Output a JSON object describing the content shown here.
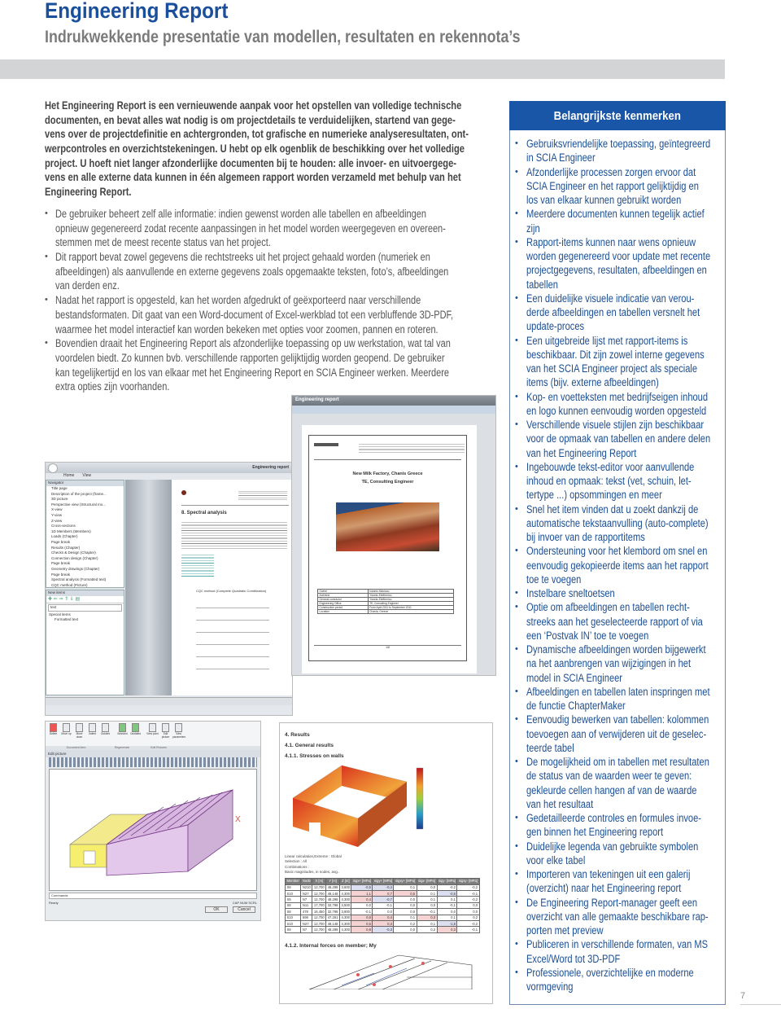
{
  "header": {
    "title": "Engineering Report",
    "subtitle": "Indrukwekkende presentatie van modellen, resultaten en rekennota’s"
  },
  "intro": {
    "lines": [
      "Het Engineering Report is een vernieuwende aanpak voor het opstellen van volledige technische",
      "documenten, en bevat alles wat nodig is om projectdetails te verduidelijken, startend van gege-",
      "vens over de projectdefinitie en achtergronden, tot grafische en numerieke analyseresultaten, ont-",
      "werpcontroles en overzichtstekeningen. U hebt op elk ogenblik de beschikking over het volledige",
      "project. U hoeft niet langer afzonderlijke documenten bij te houden: alle invoer- en uitvoergege-",
      "vens en alle externe data kunnen in één algemeen rapport worden verzameld met behulp van het",
      "Engineering Report."
    ]
  },
  "bullets": [
    {
      "lines": [
        "De gebruiker beheert zelf alle informatie: indien gewenst worden alle tabellen en afbeeldingen",
        "opnieuw gegenereerd zodat recente aanpassingen in het model worden weergegeven en overeen-",
        "stemmen met de meest recente status van het project."
      ]
    },
    {
      "lines": [
        "Dit rapport bevat zowel gegevens die rechtstreeks uit het project gehaald worden (numeriek en",
        "afbeeldingen) als aanvullende en externe gegevens zoals opgemaakte teksten, foto’s, afbeeldingen",
        "van derden enz."
      ]
    },
    {
      "lines": [
        "Nadat het rapport is opgesteld, kan het worden afgedrukt of geëxporteerd naar verschillende",
        "bestandsformaten. Dit gaat van een Word-document of Excel-werkblad tot een verbluffende 3D-PDF,",
        "waarmee het model interactief kan worden bekeken met opties voor zoomen, pannen en roteren."
      ]
    },
    {
      "lines": [
        "Bovendien draait het Engineering Report als afzonderlijke toepassing op uw werkstation, wat tal van",
        "voordelen biedt. Zo kunnen bvb. verschillende rapporten gelijktijdig worden geopend. De gebruiker",
        "kan tegelijkertijd en los van elkaar met het Engineering Report en SCIA Engineer werken. Meerdere",
        "extra opties zijn voorhanden."
      ]
    }
  ],
  "sidebar": {
    "title": "Belangrijkste kenmerken",
    "accent": "#1a56a8",
    "items": [
      {
        "lines": [
          "Gebruiksvriendelijke toepassing, geïntegreerd",
          "in SCIA Engineer"
        ]
      },
      {
        "lines": [
          "Afzonderlijke processen zorgen ervoor dat",
          "SCIA Engineer en het rapport gelijktijdig en",
          "los van elkaar kunnen gebruikt worden"
        ]
      },
      {
        "lines": [
          "Meerdere documenten kunnen tegelijk actief",
          "zijn"
        ]
      },
      {
        "lines": [
          "Rapport-items kunnen naar wens opnieuw",
          "worden gegenereerd voor update met recente",
          "projectgegevens, resultaten, afbeeldingen en",
          "tabellen"
        ]
      },
      {
        "lines": [
          "Een duidelijke visuele indicatie van verou-",
          "derde afbeeldingen en tabellen versnelt het",
          "update-proces"
        ]
      },
      {
        "lines": [
          "Een uitgebreide lijst met rapport-items is",
          "beschikbaar. Dit zijn zowel interne gegevens",
          "van het SCIA Engineer project als speciale",
          "items (bijv. externe afbeeldingen)"
        ]
      },
      {
        "lines": [
          "Kop- en voetteksten met bedrijfseigen inhoud",
          "en logo kunnen eenvoudig worden opgesteld"
        ]
      },
      {
        "lines": [
          "Verschillende visuele stijlen zijn beschikbaar",
          "voor de opmaak van tabellen en andere delen",
          "van het Engineering Report"
        ]
      },
      {
        "lines": [
          "Ingebouwde tekst-editor voor aanvullende",
          "inhoud en opmaak: tekst (vet, schuin, let-",
          "tertype ...) opsommingen en meer"
        ]
      },
      {
        "lines": [
          "Snel het item vinden dat u zoekt dankzij de",
          "automatische tekstaanvulling (auto-complete)",
          "bij invoer van de rapportitems"
        ]
      },
      {
        "lines": [
          "Ondersteuning voor het klembord om snel en",
          "eenvoudig gekopieerde items aan het rapport",
          "toe te voegen"
        ]
      },
      {
        "lines": [
          "Instelbare sneltoetsen"
        ]
      },
      {
        "lines": [
          "Optie om afbeeldingen en tabellen recht-",
          "streeks aan het geselecteerde rapport of via",
          "een ‘Postvak IN’ toe te voegen"
        ]
      },
      {
        "lines": [
          "Dynamische afbeeldingen worden bijgewerkt",
          "na het aanbrengen van wijzigingen in het",
          "model in SCIA Engineer"
        ]
      },
      {
        "lines": [
          "Afbeeldingen en tabellen laten inspringen met",
          "de functie ChapterMaker"
        ]
      },
      {
        "lines": [
          "Eenvoudig bewerken van tabellen: kolommen",
          "toevoegen aan of verwijderen uit de geselec-",
          "teerde tabel"
        ]
      },
      {
        "lines": [
          "De mogelijkheid om in tabellen met resultaten",
          "de status van de waarden weer te geven:",
          "gekleurde cellen hangen af van de waarde",
          "van het resultaat"
        ]
      },
      {
        "lines": [
          "Gedetailleerde controles en formules invoe-",
          "gen binnen het Engineering report"
        ]
      },
      {
        "lines": [
          "Duidelijke legenda van gebruikte symbolen",
          "voor elke tabel"
        ]
      },
      {
        "lines": [
          "Importeren van tekeningen uit een galerij",
          "(overzicht) naar het Engineering report"
        ]
      },
      {
        "lines": [
          "De Engineering Report-manager geeft een",
          "overzicht van alle gemaakte beschikbare rap-",
          "porten met preview"
        ]
      },
      {
        "lines": [
          "Publiceren in verschillende formaten, van MS",
          "Excel/Word tot 3D-PDF"
        ]
      },
      {
        "lines": [
          "Professionele, overzichtelijke en moderne",
          "vormgeving"
        ]
      }
    ]
  },
  "page_number": "7",
  "shot_app": {
    "window_title": "Engineering report",
    "menu": [
      "Home",
      "View"
    ],
    "navigator_title": "Navigator",
    "navigator_items": [
      "Title page",
      "Description of the project (frame...",
      "3D picture",
      "Perspective view (Structural mo...",
      "X-view",
      "Y-view",
      "Z-view",
      "Cross-sections",
      "1D Members (Members)",
      "Loads (Chapter)",
      "Page break",
      "Results (Chapter)",
      "Checks & Design (Chapter)",
      "Connection design (Chapter)",
      "Page break",
      "Geometry drawings (Chapter)",
      "Page break",
      "Spectral analysis (Formatted text)",
      "CQC method (Picture)"
    ],
    "new_items_title": "New items",
    "search_value": "text",
    "tree": [
      "Special items",
      "Formatted text"
    ],
    "doc_heading": "8. Spectral analysis",
    "doc_formula_title": "CQC method (Complete Quadratic Combination)"
  },
  "shot_report": {
    "window_title": "Engineering report",
    "doc_title": "New Milk Factory, Chanis Greece",
    "doc_subtitle": "TE, Consulting Engineer",
    "table": [
      [
        "Owner",
        "Ioannis Nikolaou"
      ],
      [
        "Architect",
        "Yiannis Eleftheriou"
      ],
      [
        "General contractor",
        "Yiannis Eleftheriou"
      ],
      [
        "Engineering Office",
        "TE, Consulting Engineer"
      ],
      [
        "Construction period",
        "From April 2011 to September 2011"
      ],
      [
        "Location",
        "Chania, Greece"
      ]
    ],
    "page_footer": "1/8"
  },
  "shot_cad": {
    "ribbon_buttons": [
      "Delete",
      "Move up",
      "Move down",
      "Indent",
      "Outdent",
      "Selected",
      "Outdated",
      "View point",
      "Edit picture",
      "View parameters"
    ],
    "ribbon_groups": [
      "Document Item",
      "Regenerate",
      "Edit Pictures"
    ],
    "panel_title": "Edit picture",
    "axis_label": "X",
    "commands_label": "Commands",
    "status": "Ready",
    "status_right": "CAP NUM SCRL",
    "ok_label": "OK",
    "cancel_label": "Cancel"
  },
  "shot_results": {
    "h1": "4. Results",
    "h2": "4.1. General results",
    "h3": "4.1.1. Stresses on walls",
    "info": [
      "Linear calculation,Extreme : Global",
      "Selection : All",
      "Combinations :",
      "Basic magnitudes, in nodes, avg.."
    ],
    "columns": [
      "Member",
      "Node",
      "X [m]",
      "Y [m]",
      "Z [m]",
      "sigx+ [MPa]",
      "sigy+ [MPa]",
      "sigxy+ [MPa]",
      "sigx- [MPa]",
      "sigy- [MPa]",
      "sigxy- [MPa]"
    ],
    "rows": [
      [
        "S9",
        "N210",
        "12,700",
        "48,298",
        "3,600",
        "-0,5",
        "-0,4",
        "0,1",
        "0,0",
        "-0,2",
        "-0,2"
      ],
      [
        "S10",
        "N27",
        "12,700",
        "48,148",
        "4,300",
        "1,1",
        "0,7",
        "0,5",
        "0,1",
        "-0,6",
        "-0,1"
      ],
      [
        "S9",
        "N7",
        "12,700",
        "48,298",
        "4,300",
        "0,4",
        "-0,7",
        "0,0",
        "0,1",
        "0,1",
        "-0,2"
      ],
      [
        "S8",
        "N11",
        "17,700",
        "32,798",
        "3,500",
        "0,0",
        "-0,1",
        "0,0",
        "0,0",
        "-0,1",
        "0,0"
      ],
      [
        "S8",
        "478",
        "16,450",
        "32,798",
        "3,900",
        "-0,1",
        "0,0",
        "0,0",
        "-0,1",
        "0,0",
        "0,0"
      ],
      [
        "S10",
        "598",
        "12,700",
        "47,261",
        "4,300",
        "0,6",
        "0,4",
        "0,1",
        "0,3",
        "0,1",
        "0,2"
      ],
      [
        "S10",
        "N27",
        "12,700",
        "48,148",
        "4,300",
        "0,5",
        "0,3",
        "0,2",
        "0,1",
        "-1,5",
        "-0,2"
      ],
      [
        "S9",
        "N7",
        "12,700",
        "48,298",
        "4,300",
        "0,8",
        "-0,3",
        "0,0",
        "0,2",
        "0,3",
        "-0,1"
      ]
    ],
    "h4": "4.1.2. Internal forces on member; My"
  }
}
